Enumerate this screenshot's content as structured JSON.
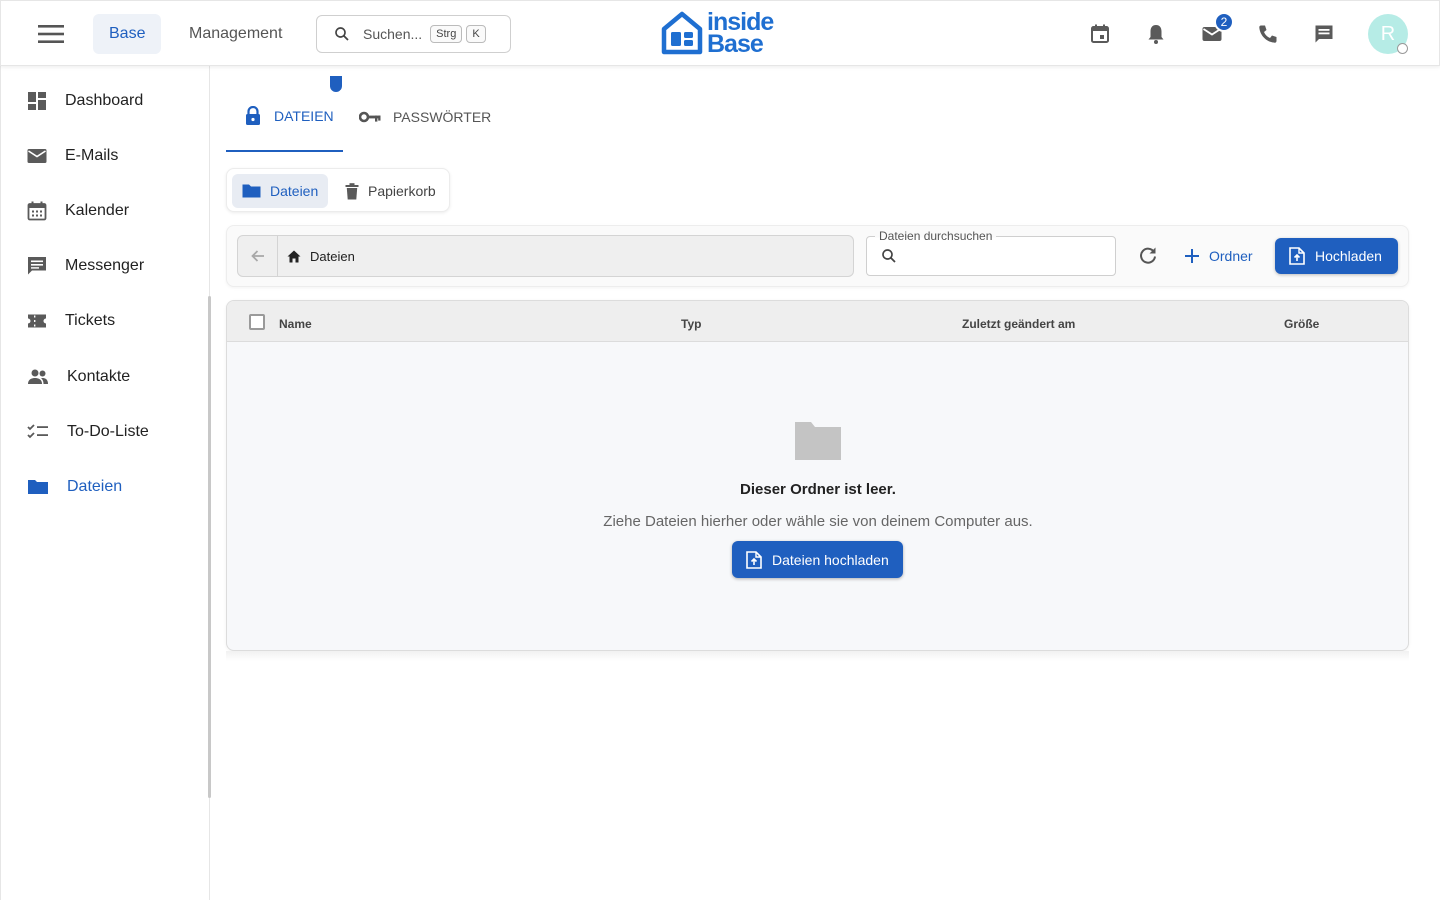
{
  "app": {
    "logo_line1": "inside",
    "logo_line2": "Base"
  },
  "header": {
    "nav_tabs": [
      {
        "label": "Base",
        "active": true
      },
      {
        "label": "Management",
        "active": false
      }
    ],
    "search": {
      "placeholder": "Suchen...",
      "shortcut_keys": [
        "Strg",
        "K"
      ]
    },
    "icons": [
      "calendar-icon",
      "bell-icon",
      "mail-icon",
      "phone-icon",
      "chat-icon"
    ],
    "mail_badge": "2",
    "avatar_initial": "R"
  },
  "sidebar": {
    "items": [
      {
        "label": "Dashboard",
        "icon": "dashboard-icon",
        "active": false
      },
      {
        "label": "E-Mails",
        "icon": "mail-icon",
        "active": false
      },
      {
        "label": "Kalender",
        "icon": "calendar-icon",
        "active": false
      },
      {
        "label": "Messenger",
        "icon": "message-icon",
        "active": false
      },
      {
        "label": "Tickets",
        "icon": "ticket-icon",
        "active": false
      },
      {
        "label": "Kontakte",
        "icon": "contacts-icon",
        "active": false
      },
      {
        "label": "To-Do-Liste",
        "icon": "checklist-icon",
        "active": false
      },
      {
        "label": "Dateien",
        "icon": "folder-icon",
        "active": true
      }
    ]
  },
  "main": {
    "tabs": [
      {
        "label": "DATEIEN",
        "icon": "lock-icon",
        "active": true
      },
      {
        "label": "PASSWÖRTER",
        "icon": "key-icon",
        "active": false
      }
    ],
    "segments": [
      {
        "label": "Dateien",
        "icon": "folder-icon",
        "active": true
      },
      {
        "label": "Papierkorb",
        "icon": "trash-icon",
        "active": false
      }
    ],
    "breadcrumb": {
      "current": "Dateien"
    },
    "file_search": {
      "label": "Dateien durchsuchen",
      "value": ""
    },
    "folder_button": "Ordner",
    "upload_button": "Hochladen",
    "table": {
      "columns": [
        "Name",
        "Typ",
        "Zuletzt geändert am",
        "Größe"
      ],
      "rows": []
    },
    "empty_state": {
      "title": "Dieser Ordner ist leer.",
      "subtitle": "Ziehe Dateien hierher oder wähle sie von deinem Computer aus.",
      "button": "Dateien hochladen"
    }
  },
  "colors": {
    "accent": "#1f5fbf",
    "avatar_bg": "#b6ece6"
  }
}
